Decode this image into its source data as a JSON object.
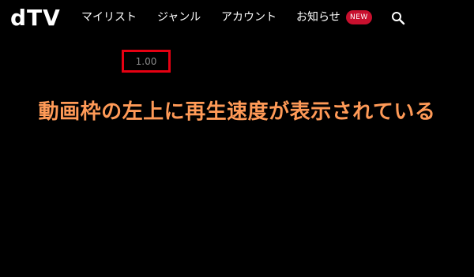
{
  "header": {
    "logo": "dTV",
    "nav": {
      "mylist": "マイリスト",
      "genre": "ジャンル",
      "account": "アカウント",
      "news": "お知らせ"
    },
    "new_badge": "NEW",
    "search_icon": "search-icon"
  },
  "player": {
    "speed": "1.00"
  },
  "annotation": {
    "caption": "動画枠の左上に再生速度が表示されている"
  },
  "colors": {
    "background": "#000000",
    "badge": "#c8102e",
    "highlight_border": "#e60012",
    "caption": "#ff9a57"
  }
}
